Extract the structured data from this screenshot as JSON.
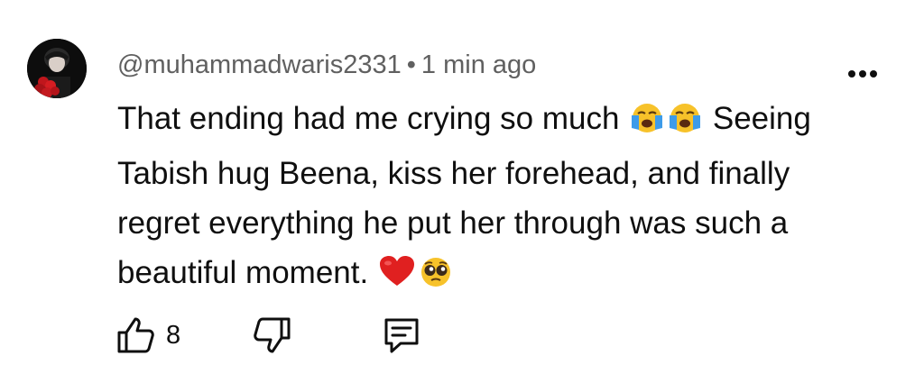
{
  "comment": {
    "author": "@muhammadwaris2331",
    "separator": "•",
    "time": "1 min ago",
    "lines": [
      [
        "That ending had me crying so much ",
        "loudly-crying-face",
        "loudly-crying-face",
        " Seeing"
      ],
      [
        "Tabish hug Beena, kiss her forehead, and finally"
      ],
      [
        "regret everything he put her through was such a"
      ],
      [
        "beautiful moment. ",
        "red-heart",
        "pleading-face"
      ]
    ],
    "line_1_text": "That ending had me crying so much ",
    "line_1_tail": " Seeing",
    "line_2": "Tabish hug Beena, kiss her forehead, and finally",
    "line_3": "regret everything he put her through was such a",
    "line_4_text": "beautiful moment. "
  },
  "actions": {
    "like_count": "8",
    "like_icon": "thumbs-up-icon",
    "dislike_icon": "thumbs-down-icon",
    "reply_icon": "reply-comment-icon",
    "more_icon": "more-options-icon"
  },
  "colors": {
    "text": "#0f0f0f",
    "meta": "#606060",
    "heart": "#e02020",
    "emoji_yellow": "#f7c22a",
    "tears_blue": "#3d9be9"
  }
}
